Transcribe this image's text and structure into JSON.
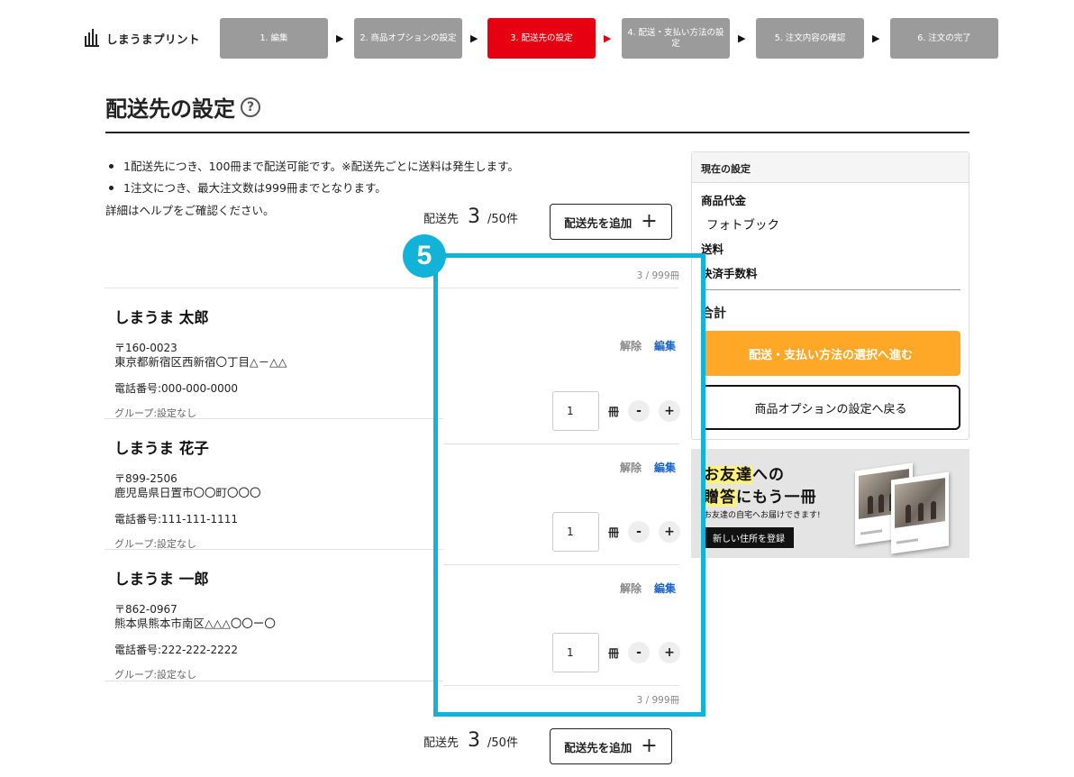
{
  "header": {
    "logo_text": "しまうまプリント",
    "steps": [
      {
        "label": "1. 編集",
        "active": false
      },
      {
        "label": "2. 商品オプションの設定",
        "active": false
      },
      {
        "label": "3. 配送先の設定",
        "active": true
      },
      {
        "label": "4. 配送・支払い方法の設定",
        "active": false
      },
      {
        "label": "5. 注文内容の確認",
        "active": false
      },
      {
        "label": "6. 注文の完了",
        "active": false
      }
    ],
    "step_arrow": "▶"
  },
  "page": {
    "title": "配送先の設定",
    "help_icon": "?"
  },
  "notes": {
    "items": [
      "1配送先につき、100冊まで配送可能です。※配送先ごとに送料は発生します。",
      "1注文につき、最大注文数は999冊までとなります。"
    ],
    "detail": "詳細はヘルプをご確認ください。"
  },
  "destinations": {
    "label": "配送先",
    "count": "3",
    "capacity": "/50件",
    "add_label": "配送先を追加",
    "add_icon": "+",
    "total_books": "3 / 999冊"
  },
  "addresses": [
    {
      "name": "しまうま 太郎",
      "zip": "〒160-0023",
      "street": "東京都新宿区西新宿〇丁目△－△△",
      "phone": "電話番号:000-000-0000",
      "group": "グループ:設定なし",
      "release": "解除",
      "edit": "編集",
      "quantity": "1",
      "unit": "冊",
      "minus": "-",
      "plus": "+"
    },
    {
      "name": "しまうま 花子",
      "zip": "〒899-2506",
      "street": "鹿児島県日置市〇〇町〇〇〇",
      "phone": "電話番号:111-111-1111",
      "group": "グループ:設定なし",
      "release": "解除",
      "edit": "編集",
      "quantity": "1",
      "unit": "冊",
      "minus": "-",
      "plus": "+"
    },
    {
      "name": "しまうま 一郎",
      "zip": "〒862-0967",
      "street": "熊本県熊本市南区△△△〇〇ー〇",
      "phone": "電話番号:222-222-2222",
      "group": "グループ:設定なし",
      "release": "解除",
      "edit": "編集",
      "quantity": "1",
      "unit": "冊",
      "minus": "-",
      "plus": "+"
    }
  ],
  "annotation": {
    "badge": "5",
    "color": "#12b2d9"
  },
  "summary": {
    "heading": "現在の設定",
    "product_label": "商品代金",
    "product_item": "フォトブック",
    "shipping_label": "送料",
    "fee_label": "決済手数料",
    "total_label": "合計",
    "proceed_label": "配送・支払い方法の選択へ進む",
    "back_label": "商品オプションの設定へ戻る",
    "proceed_color": "#ffa726"
  },
  "banner": {
    "line1_hl": "お友達",
    "line1_rest": "への",
    "line2_hl": "贈答",
    "line2_rest": "にもう一冊",
    "line3": "お友達の自宅へお届けできます!",
    "button": "新しい住所を登録"
  },
  "colors": {
    "active_step": "#e60012",
    "inactive_step": "#9b9b9b",
    "edit_link": "#1a64c8"
  }
}
